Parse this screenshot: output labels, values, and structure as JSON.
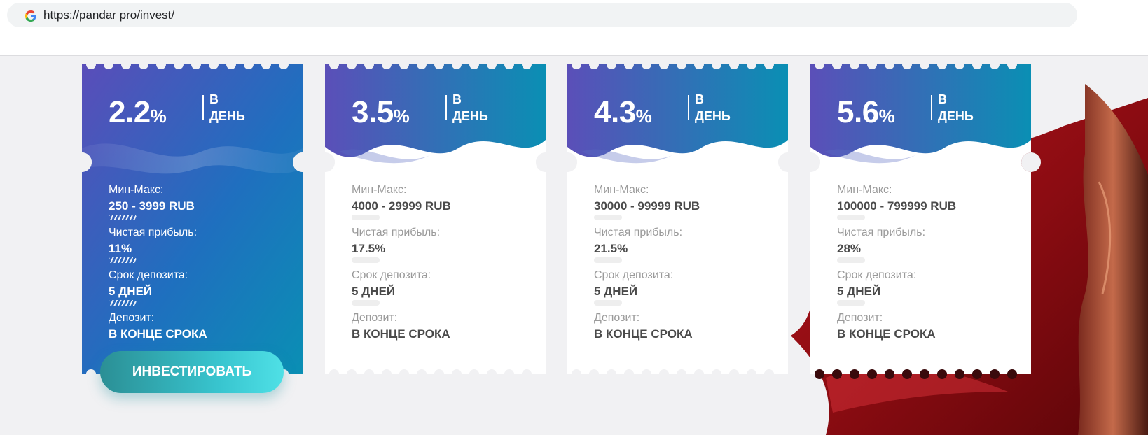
{
  "browser": {
    "url": "https://pandar pro/invest/"
  },
  "colors": {
    "gradient_start": "#5b4fb8",
    "gradient_end": "#0a8fb4",
    "button_start": "#2b8f95",
    "button_end": "#4fe0e6"
  },
  "plans": [
    {
      "rate": "2.2",
      "unit": "%",
      "per_line1": "В",
      "per_line2": "ДЕНЬ",
      "minmax_label": "Мин-Макс:",
      "minmax_value": "250 - 3999 RUB",
      "profit_label": "Чистая прибыль:",
      "profit_value": "11%",
      "term_label": "Срок депозита:",
      "term_value": "5 ДНЕЙ",
      "deposit_label": "Депозит:",
      "deposit_value": "В КОНЦЕ СРОКА"
    },
    {
      "rate": "3.5",
      "unit": "%",
      "per_line1": "В",
      "per_line2": "ДЕНЬ",
      "minmax_label": "Мин-Макс:",
      "minmax_value": "4000 - 29999 RUB",
      "profit_label": "Чистая прибыль:",
      "profit_value": "17.5%",
      "term_label": "Срок депозита:",
      "term_value": "5 ДНЕЙ",
      "deposit_label": "Депозит:",
      "deposit_value": "В КОНЦЕ СРОКА"
    },
    {
      "rate": "4.3",
      "unit": "%",
      "per_line1": "В",
      "per_line2": "ДЕНЬ",
      "minmax_label": "Мин-Макс:",
      "minmax_value": "30000 - 99999 RUB",
      "profit_label": "Чистая прибыль:",
      "profit_value": "21.5%",
      "term_label": "Срок депозита:",
      "term_value": "5 ДНЕЙ",
      "deposit_label": "Депозит:",
      "deposit_value": "В КОНЦЕ СРОКА"
    },
    {
      "rate": "5.6",
      "unit": "%",
      "per_line1": "В",
      "per_line2": "ДЕНЬ",
      "minmax_label": "Мин-Макс:",
      "minmax_value": "100000 - 799999 RUB",
      "profit_label": "Чистая прибыль:",
      "profit_value": "28%",
      "term_label": "Срок депозита:",
      "term_value": "5 ДНЕЙ",
      "deposit_label": "Депозит:",
      "deposit_value": "В КОНЦЕ СРОКА"
    }
  ],
  "invest_button": {
    "label": "ИНВЕСТИРОВАТЬ"
  }
}
